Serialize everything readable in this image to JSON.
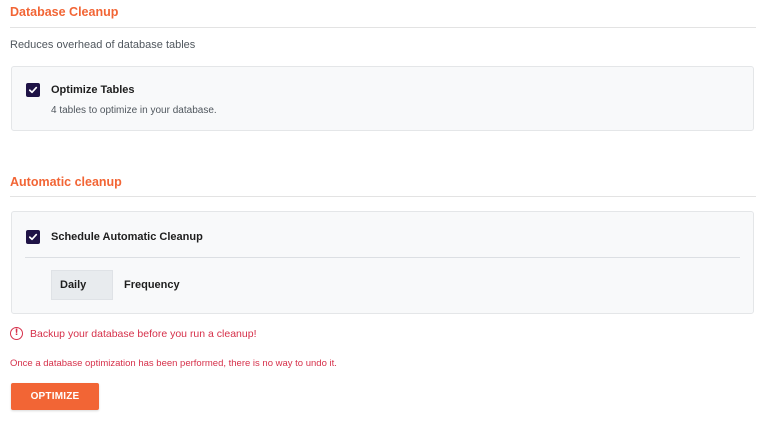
{
  "database_cleanup": {
    "title": "Database Cleanup",
    "description": "Reduces overhead of database tables",
    "optimize_tables": {
      "label": "Optimize Tables",
      "description": "4 tables to optimize in your database.",
      "checked": true
    }
  },
  "automatic_cleanup": {
    "title": "Automatic cleanup",
    "schedule": {
      "label": "Schedule Automatic Cleanup",
      "checked": true
    },
    "frequency": {
      "selected": "Daily",
      "label": "Frequency"
    }
  },
  "warning": {
    "icon": "exclamation-circle-icon",
    "backup_text": "Backup your database before you run a cleanup!",
    "undo_text": "Once a database optimization has been performed, there is no way to undo it."
  },
  "actions": {
    "optimize_label": "OPTIMIZE"
  },
  "colors": {
    "accent": "#f26535",
    "checkbox": "#1f1346",
    "warning": "#d6304a"
  }
}
